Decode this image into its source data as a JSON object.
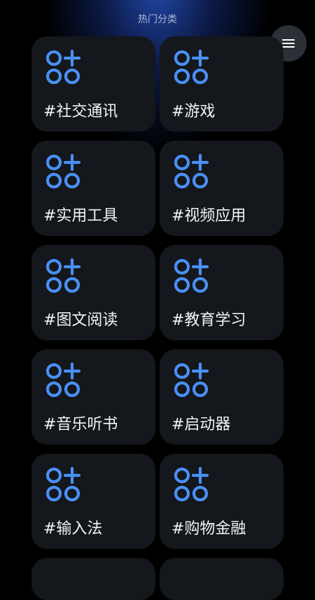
{
  "header": {
    "title": "热门分类"
  },
  "menu": {
    "icon": "hamburger-menu-icon"
  },
  "categories": [
    {
      "label": "#社交通讯",
      "icon": "apps-add-icon"
    },
    {
      "label": "#游戏",
      "icon": "apps-add-icon"
    },
    {
      "label": "#实用工具",
      "icon": "apps-add-icon"
    },
    {
      "label": "#视频应用",
      "icon": "apps-add-icon"
    },
    {
      "label": "#图文阅读",
      "icon": "apps-add-icon"
    },
    {
      "label": "#教育学习",
      "icon": "apps-add-icon"
    },
    {
      "label": "#音乐听书",
      "icon": "apps-add-icon"
    },
    {
      "label": "#启动器",
      "icon": "apps-add-icon"
    },
    {
      "label": "#输入法",
      "icon": "apps-add-icon"
    },
    {
      "label": "#购物金融",
      "icon": "apps-add-icon"
    }
  ],
  "colors": {
    "background": "#000000",
    "card": "#14171c",
    "accent_icon": "#4a90f5",
    "label": "#f2f4f8",
    "title": "#a9b7d6",
    "menu_button": "#2b2f36"
  }
}
